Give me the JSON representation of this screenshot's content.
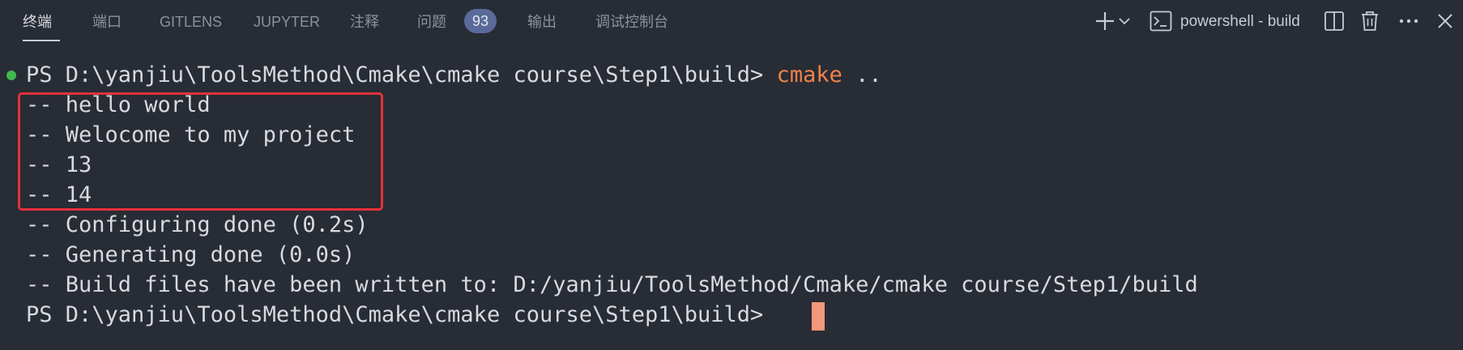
{
  "tabs": [
    {
      "label": "终端",
      "active": true
    },
    {
      "label": "端口",
      "active": false
    },
    {
      "label": "GITLENS",
      "active": false
    },
    {
      "label": "JUPYTER",
      "active": false
    },
    {
      "label": "注释",
      "active": false
    },
    {
      "label": "问题",
      "active": false
    },
    {
      "label": "输出",
      "active": false
    },
    {
      "label": "调试控制台",
      "active": false
    }
  ],
  "problems_badge": "93",
  "toolbar": {
    "terminal_name": "powershell - build",
    "icons": [
      "plus-icon",
      "chevron-down-icon",
      "terminal-icon",
      "split-icon",
      "trash-icon",
      "more-icon",
      "close-icon"
    ]
  },
  "terminal": {
    "prompt": "PS D:\\yanjiu\\ToolsMethod\\Cmake\\cmake course\\Step1\\build> ",
    "command": "cmake",
    "command_args": " ..",
    "output": [
      "-- hello world",
      "-- Welocome to my project",
      "-- 13",
      "-- 14",
      "-- Configuring done (0.2s)",
      "-- Generating done (0.0s)",
      "-- Build files have been written to: D:/yanjiu/ToolsMethod/Cmake/cmake course/Step1/build"
    ],
    "final_prompt": "PS D:\\yanjiu\\ToolsMethod\\Cmake\\cmake course\\Step1\\build> "
  },
  "colors": {
    "background": "#282c34",
    "command": "#f0824a",
    "highlight_border": "#e5303b",
    "success_dot": "#3fb950",
    "cursor": "#f5977a"
  }
}
